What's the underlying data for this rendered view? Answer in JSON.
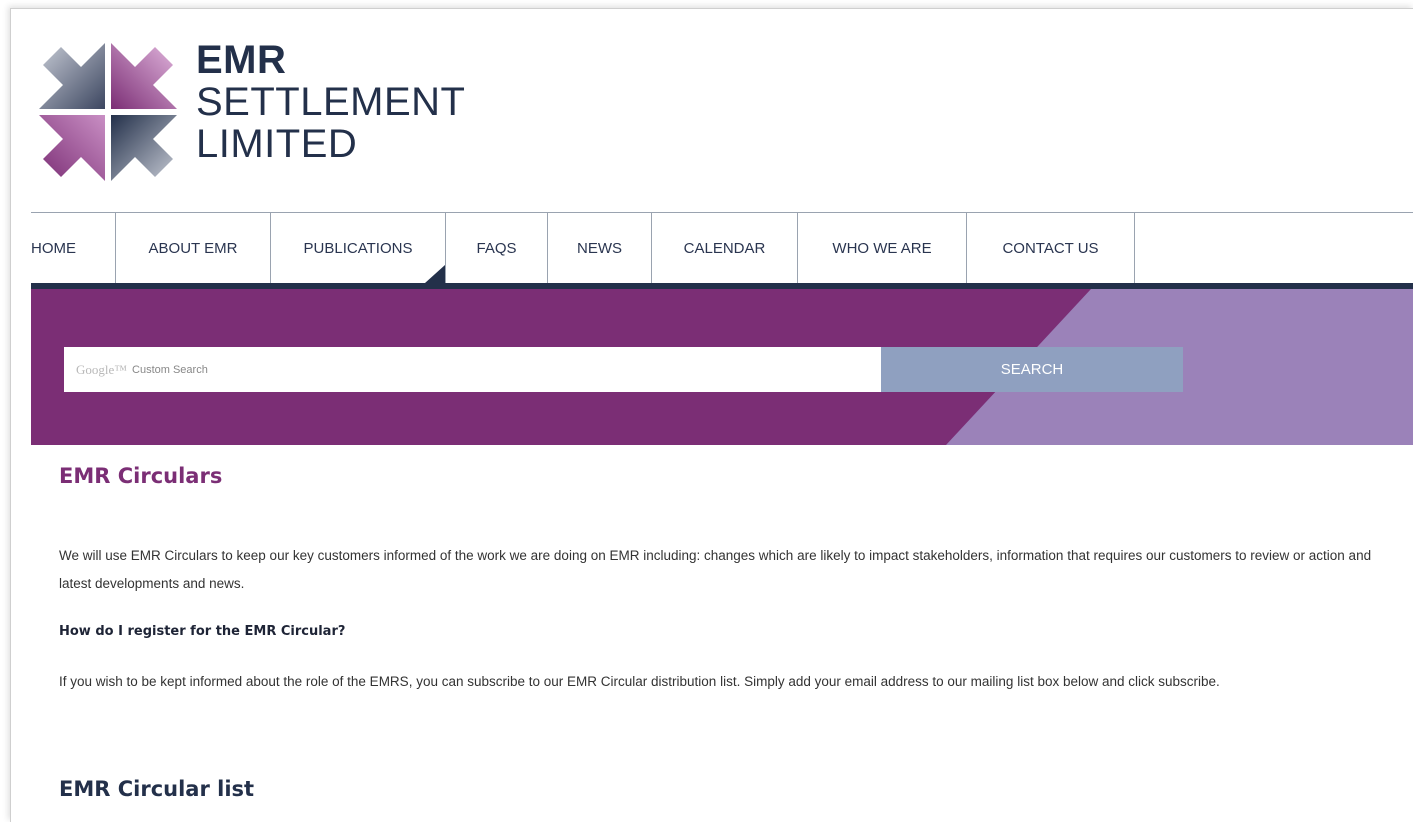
{
  "brand": {
    "line1": "EMR",
    "line2": "SETTLEMENT",
    "line3": "LIMITED",
    "colors": {
      "navy": "#23304a",
      "purple": "#7b2e75",
      "lavender": "#9b82b9"
    }
  },
  "nav": {
    "items": [
      {
        "label": "HOME"
      },
      {
        "label": "ABOUT EMR"
      },
      {
        "label": "PUBLICATIONS"
      },
      {
        "label": "FAQS"
      },
      {
        "label": "NEWS"
      },
      {
        "label": "CALENDAR"
      },
      {
        "label": "WHO WE ARE"
      },
      {
        "label": "CONTACT US"
      }
    ],
    "active": "PUBLICATIONS"
  },
  "search": {
    "google_mark": "Google™",
    "placeholder": "Custom Search",
    "button_label": "SEARCH"
  },
  "content": {
    "title": "EMR Circulars",
    "intro": "We will use EMR Circulars to keep our key customers informed of the work we are doing on EMR including: changes which are likely to impact stakeholders, information that requires our customers to review or action and latest developments and news.",
    "question": "How do I register for the EMR Circular?",
    "answer": "If you wish to be kept informed about the role of the EMRS, you can subscribe to our EMR Circular distribution list. Simply add your email address to our mailing list box below and click subscribe.",
    "list_heading": "EMR Circular list"
  }
}
